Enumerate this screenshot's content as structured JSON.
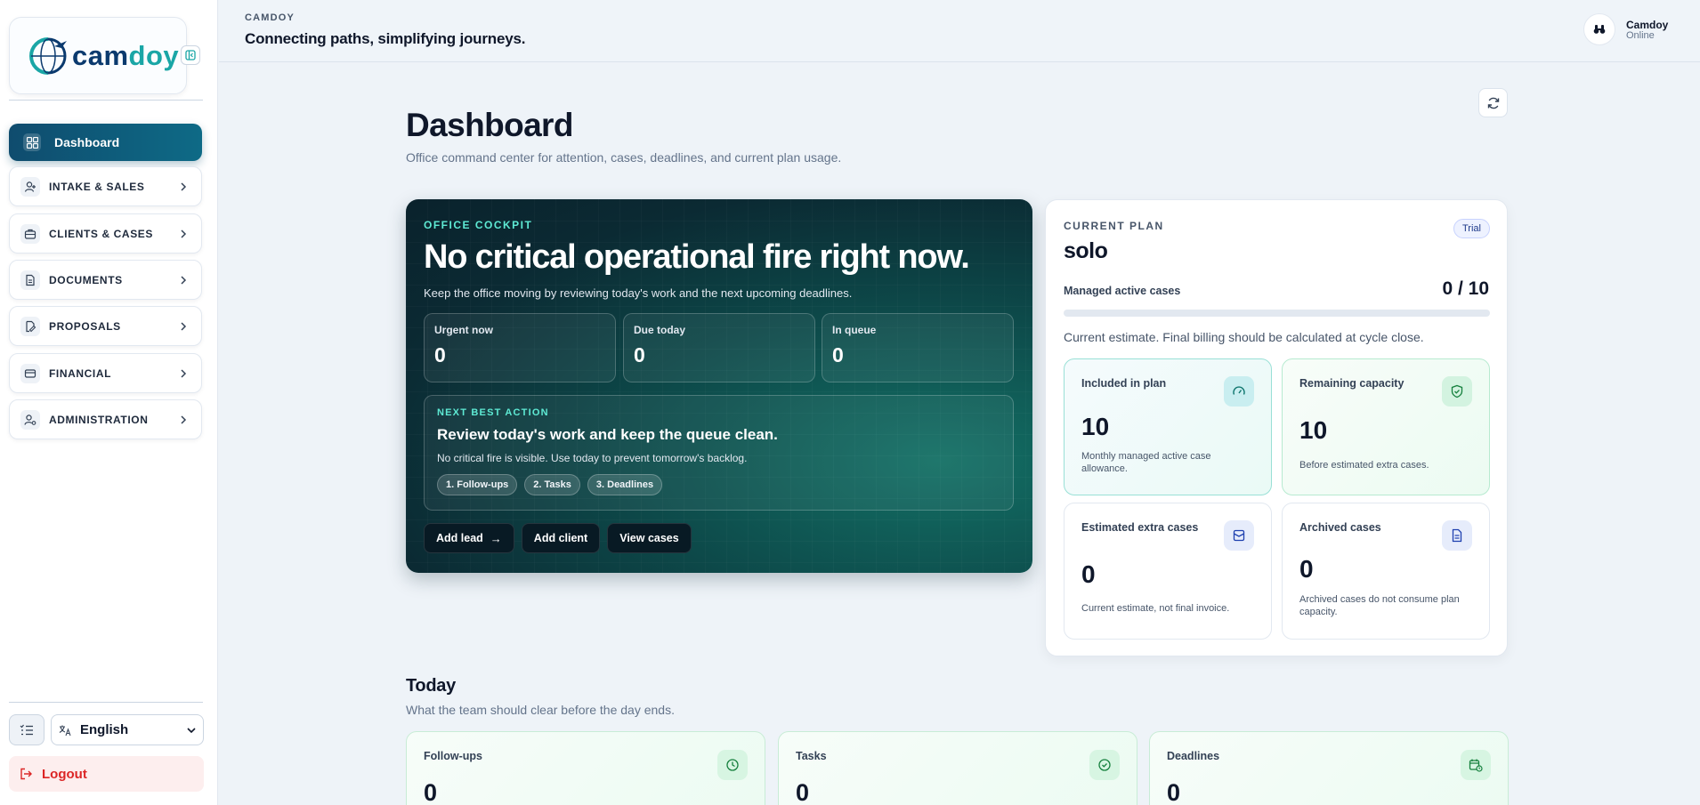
{
  "sidebar": {
    "logo": {
      "prefix": "cam",
      "suffix": "doy"
    },
    "active_item": "Dashboard",
    "items": [
      {
        "label": "INTAKE & SALES",
        "icon": "user-plus-icon"
      },
      {
        "label": "CLIENTS & CASES",
        "icon": "briefcase-icon"
      },
      {
        "label": "DOCUMENTS",
        "icon": "document-icon"
      },
      {
        "label": "PROPOSALS",
        "icon": "edit-document-icon"
      },
      {
        "label": "FINANCIAL",
        "icon": "credit-card-icon"
      },
      {
        "label": "ADMINISTRATION",
        "icon": "user-settings-icon"
      }
    ],
    "language": "English",
    "logout": "Logout"
  },
  "header": {
    "brand": "CAMDOY",
    "tagline": "Connecting paths, simplifying journeys.",
    "user_name": "Camdoy",
    "user_status": "Online"
  },
  "page": {
    "title": "Dashboard",
    "subtitle": "Office command center for attention, cases, deadlines, and current plan usage."
  },
  "cockpit": {
    "kicker": "OFFICE COCKPIT",
    "title": "No critical operational fire right now.",
    "description": "Keep the office moving by reviewing today's work and the next upcoming deadlines.",
    "stats": [
      {
        "label": "Urgent now",
        "value": "0"
      },
      {
        "label": "Due today",
        "value": "0"
      },
      {
        "label": "In queue",
        "value": "0"
      }
    ],
    "next_action": {
      "kicker": "NEXT BEST ACTION",
      "title": "Review today's work and keep the queue clean.",
      "description": "No critical fire is visible. Use today to prevent tomorrow's backlog.",
      "steps": [
        "1. Follow-ups",
        "2. Tasks",
        "3. Deadlines"
      ]
    },
    "buttons": {
      "add_lead": "Add lead",
      "add_client": "Add client",
      "view_cases": "View cases"
    }
  },
  "plan": {
    "kicker": "CURRENT PLAN",
    "badge": "Trial",
    "name": "solo",
    "metric_label": "Managed active cases",
    "metric_value": "0 / 10",
    "usage_fraction": 0,
    "note": "Current estimate. Final billing should be calculated at cycle close.",
    "cards": [
      {
        "label": "Included in plan",
        "value": "10",
        "description": "Monthly managed active case allowance."
      },
      {
        "label": "Remaining capacity",
        "value": "10",
        "description": "Before estimated extra cases."
      },
      {
        "label": "Estimated extra cases",
        "value": "0",
        "description": "Current estimate, not final invoice."
      },
      {
        "label": "Archived cases",
        "value": "0",
        "description": "Archived cases do not consume plan capacity."
      }
    ]
  },
  "today": {
    "title": "Today",
    "subtitle": "What the team should clear before the day ends.",
    "cards": [
      {
        "label": "Follow-ups",
        "value": "0"
      },
      {
        "label": "Tasks",
        "value": "0"
      },
      {
        "label": "Deadlines",
        "value": "0"
      }
    ]
  },
  "colors": {
    "accent": "#0f4c6e",
    "teal": "#5eead4",
    "danger": "#dc2626"
  }
}
